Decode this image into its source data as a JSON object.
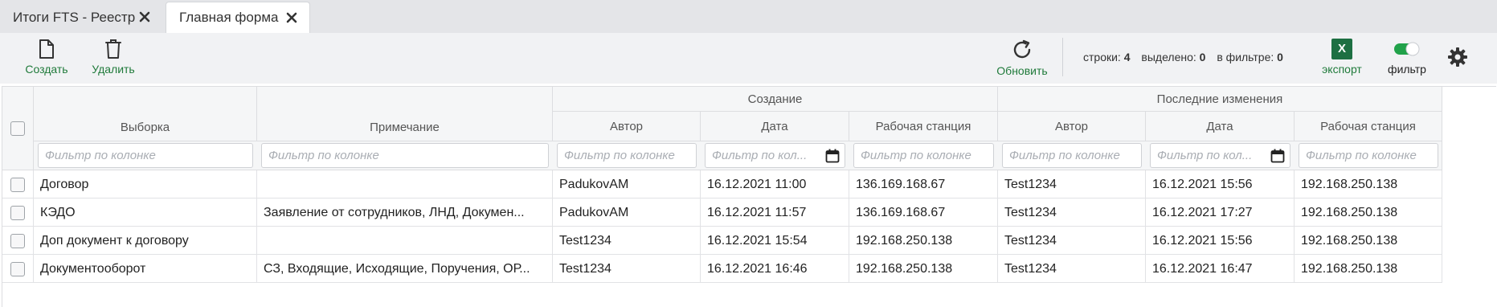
{
  "tabs": [
    {
      "label": "Итоги FTS - Реестр"
    },
    {
      "label": "Главная форма"
    }
  ],
  "toolbar": {
    "create_label": "Создать",
    "delete_label": "Удалить",
    "refresh_label": "Обновить",
    "rows_label": "строки:",
    "rows_value": "4",
    "selected_label": "выделено:",
    "selected_value": "0",
    "in_filter_label": "в фильтре:",
    "in_filter_value": "0",
    "export_label": "экспорт",
    "export_icon_text": "X",
    "filter_label": "фильтр",
    "filter_on": true
  },
  "grid": {
    "group_headers": {
      "creation": "Создание",
      "last_changes": "Последние изменения"
    },
    "columns": {
      "selection": "Выборка",
      "note": "Примечание",
      "c_author": "Автор",
      "c_date": "Дата",
      "c_station": "Рабочая станция",
      "m_author": "Автор",
      "m_date": "Дата",
      "m_station": "Рабочая станция"
    },
    "filter_placeholder": "Фильтр по колонке",
    "filter_placeholder_short": "Фильтр по кол...",
    "rows": [
      {
        "selection": "Договор",
        "note": "",
        "c_author": "PadukovAM",
        "c_date": "16.12.2021 11:00",
        "c_station": "136.169.168.67",
        "m_author": "Test1234",
        "m_date": "16.12.2021 15:56",
        "m_station": "192.168.250.138"
      },
      {
        "selection": "КЭДО",
        "note": "Заявление от сотрудников, ЛНД, Докумен...",
        "c_author": "PadukovAM",
        "c_date": "16.12.2021 11:57",
        "c_station": "136.169.168.67",
        "m_author": "Test1234",
        "m_date": "16.12.2021 17:27",
        "m_station": "192.168.250.138"
      },
      {
        "selection": "Доп документ к договору",
        "note": "",
        "c_author": "Test1234",
        "c_date": "16.12.2021 15:54",
        "c_station": "192.168.250.138",
        "m_author": "Test1234",
        "m_date": "16.12.2021 15:56",
        "m_station": "192.168.250.138"
      },
      {
        "selection": "Документооборот",
        "note": "СЗ, Входящие, Исходящие, Поручения, ОР...",
        "c_author": "Test1234",
        "c_date": "16.12.2021 16:46",
        "c_station": "192.168.250.138",
        "m_author": "Test1234",
        "m_date": "16.12.2021 16:47",
        "m_station": "192.168.250.138"
      }
    ]
  },
  "colors": {
    "accent_green": "#1f7a3a",
    "excel_green": "#1d6f42",
    "toggle_green": "#21a24a"
  }
}
